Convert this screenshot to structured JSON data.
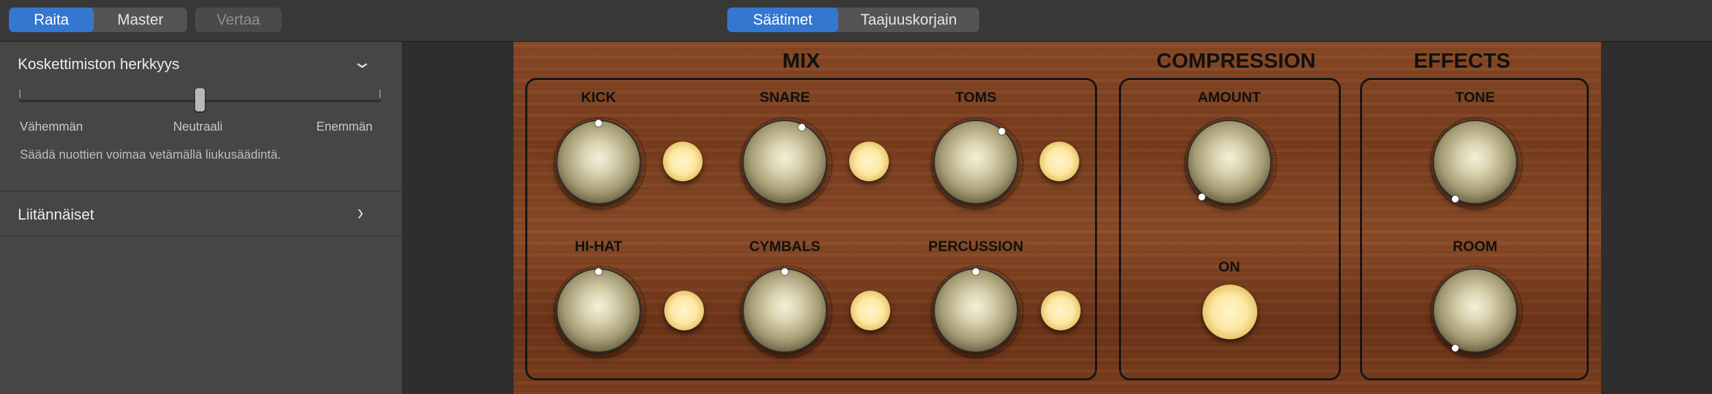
{
  "topbar": {
    "left_tabs": [
      {
        "label": "Raita",
        "active": true
      },
      {
        "label": "Master",
        "active": false
      }
    ],
    "compare_label": "Vertaa",
    "center_tabs": [
      {
        "label": "Säätimet",
        "active": true
      },
      {
        "label": "Taajuuskorjain",
        "active": false
      }
    ]
  },
  "sidebar": {
    "velocity": {
      "title": "Koskettimiston herkkyys",
      "expanded": true,
      "slider_value": "Neutraali",
      "labels": {
        "min": "Vähemmän",
        "mid": "Neutraali",
        "max": "Enemmän"
      },
      "description": "Säädä nuottien voimaa vetämällä liukusäädintä."
    },
    "plugins": {
      "title": "Liitännäiset",
      "expanded": false
    }
  },
  "instrument": {
    "mix": {
      "title": "MIX",
      "channels": [
        {
          "label": "KICK"
        },
        {
          "label": "SNARE"
        },
        {
          "label": "TOMS"
        },
        {
          "label": "HI-HAT"
        },
        {
          "label": "CYMBALS"
        },
        {
          "label": "PERCUSSION"
        }
      ]
    },
    "compression": {
      "title": "COMPRESSION",
      "amount_label": "AMOUNT",
      "on_label": "ON"
    },
    "effects": {
      "title": "EFFECTS",
      "tone_label": "TONE",
      "room_label": "ROOM"
    }
  },
  "colors": {
    "accent": "#3477d0",
    "wood": "#7f4221",
    "led": "#fde8a4"
  }
}
